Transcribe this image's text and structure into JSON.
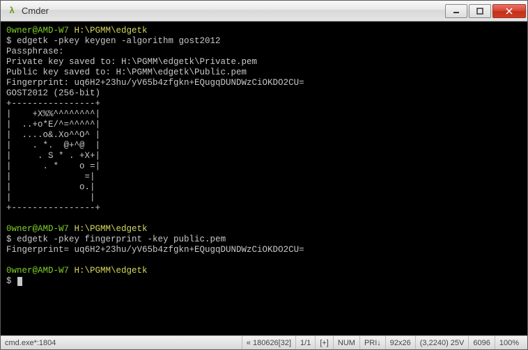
{
  "window": {
    "icon": "λ",
    "title": "Cmder"
  },
  "terminal": {
    "prompt1_user": "0wner@AMD-W7",
    "prompt1_path": "H:\\PGMM\\edgetk",
    "cmd1_prefix": "$ ",
    "cmd1": "edgetk -pkey keygen -algorithm gost2012",
    "line_passphrase": "Passphrase:",
    "line_priv": "Private key saved to: H:\\PGMM\\edgetk\\Private.pem",
    "line_pub": "Public key saved to: H:\\PGMM\\edgetk\\Public.pem",
    "line_fp": "Fingerprint: uq6H2+23hu/yV65b4zfgkn+EQugqDUNDWzCiOKDO2CU=",
    "line_algo": "GOST2012 (256-bit)",
    "art": "+----------------+\n|    +X%%^^^^^^^^|\n|  ..+o*E/^=^^^^^|\n|  ....o&.Xo^^O^ |\n|    . *.  @+^@  |\n|     . S * . +X+|\n|      . *    o =|\n|              =|\n|             o.|\n|               |\n+----------------+",
    "prompt2_user": "0wner@AMD-W7",
    "prompt2_path": "H:\\PGMM\\edgetk",
    "cmd2_prefix": "$ ",
    "cmd2": "edgetk -pkey fingerprint -key public.pem",
    "line_fp2": "Fingerprint= uq6H2+23hu/yV65b4zfgkn+EQugqDUNDWzCiOKDO2CU=",
    "prompt3_user": "0wner@AMD-W7",
    "prompt3_path": "H:\\PGMM\\edgetk",
    "cmd3_prefix": "$ "
  },
  "statusbar": {
    "left": "cmd.exe*:1804",
    "seg1": "« 180626[32]",
    "seg2": "1/1",
    "seg3": "[+]",
    "seg4": "NUM",
    "seg5": "PRI↓",
    "seg6": "92x26",
    "seg7": "(3,2240) 25V",
    "seg8": "6096",
    "seg9": "100%"
  }
}
